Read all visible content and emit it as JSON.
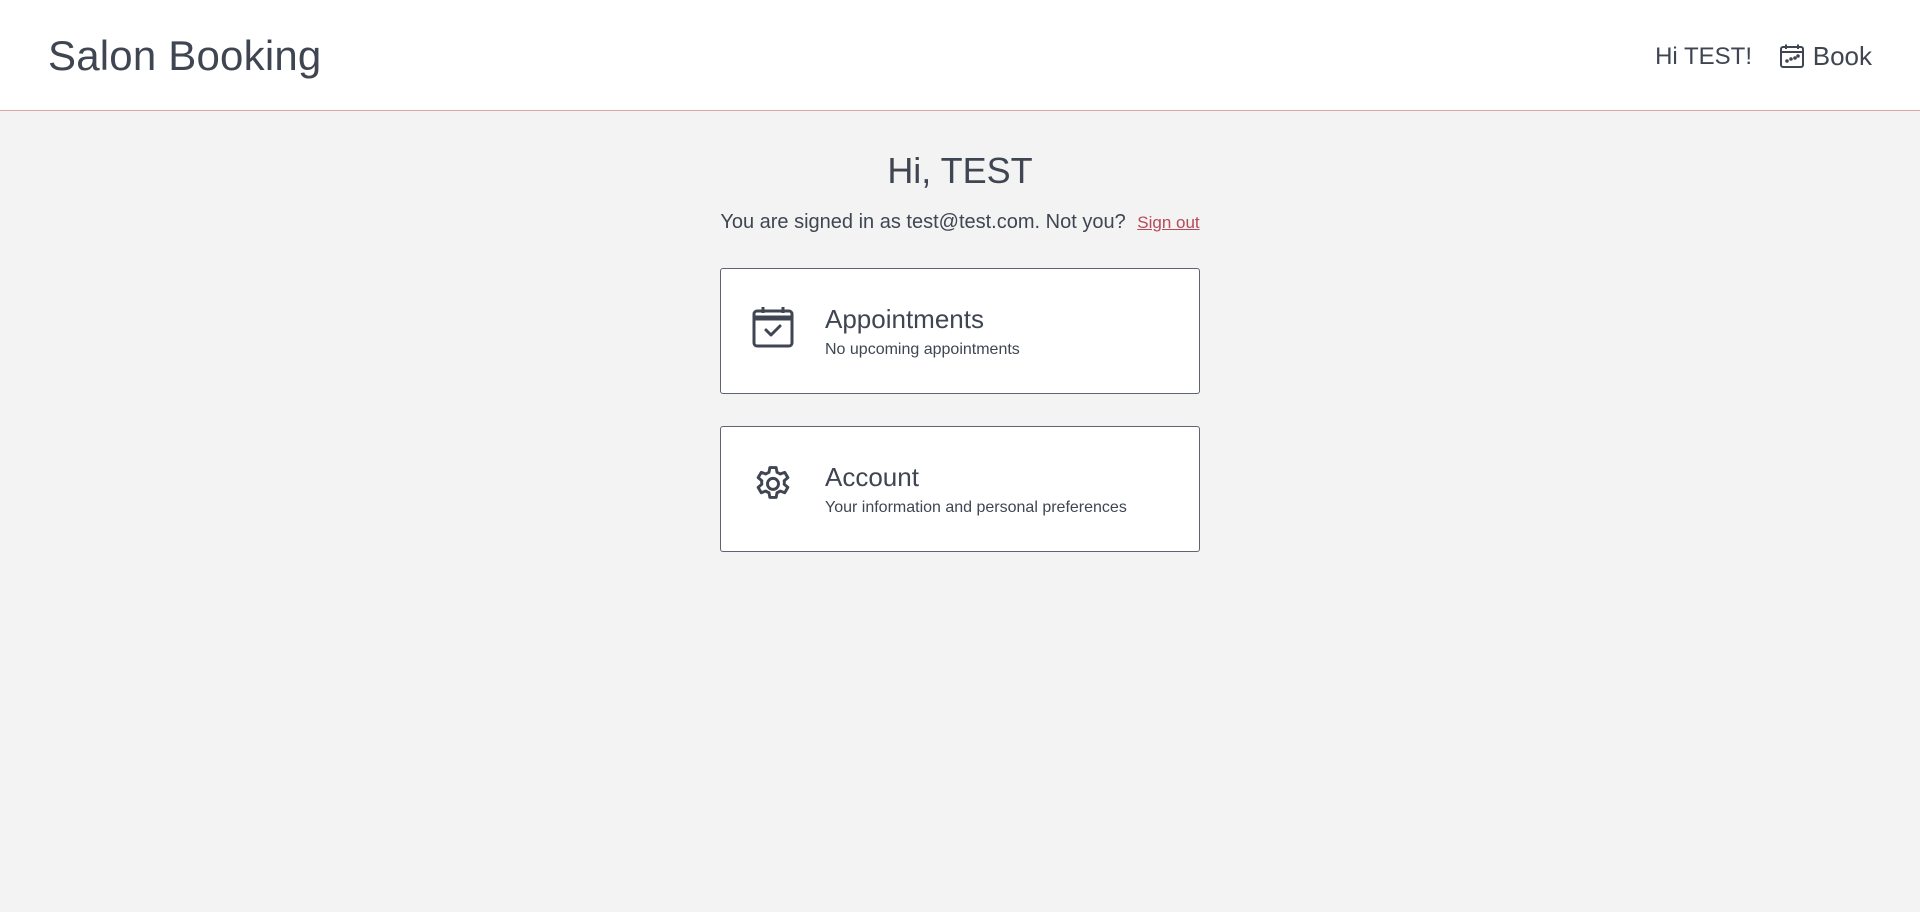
{
  "header": {
    "brand": "Salon Booking",
    "greeting": "Hi TEST!",
    "book_label": "Book",
    "book_icon": "calendar-icon"
  },
  "main": {
    "hello": "Hi, TEST",
    "signed_in_text": "You are signed in as test@test.com. Not you?",
    "signout_label": "Sign out",
    "cards": [
      {
        "title": "Appointments",
        "subtitle": "No upcoming appointments",
        "icon": "calendar-check-icon"
      },
      {
        "title": "Account",
        "subtitle": "Your information and personal preferences",
        "icon": "gear-icon"
      }
    ]
  },
  "colors": {
    "background": "#f3f3f3",
    "text": "#3f4652",
    "accent": "#b6495a",
    "header_border": "#d9a3a7"
  }
}
